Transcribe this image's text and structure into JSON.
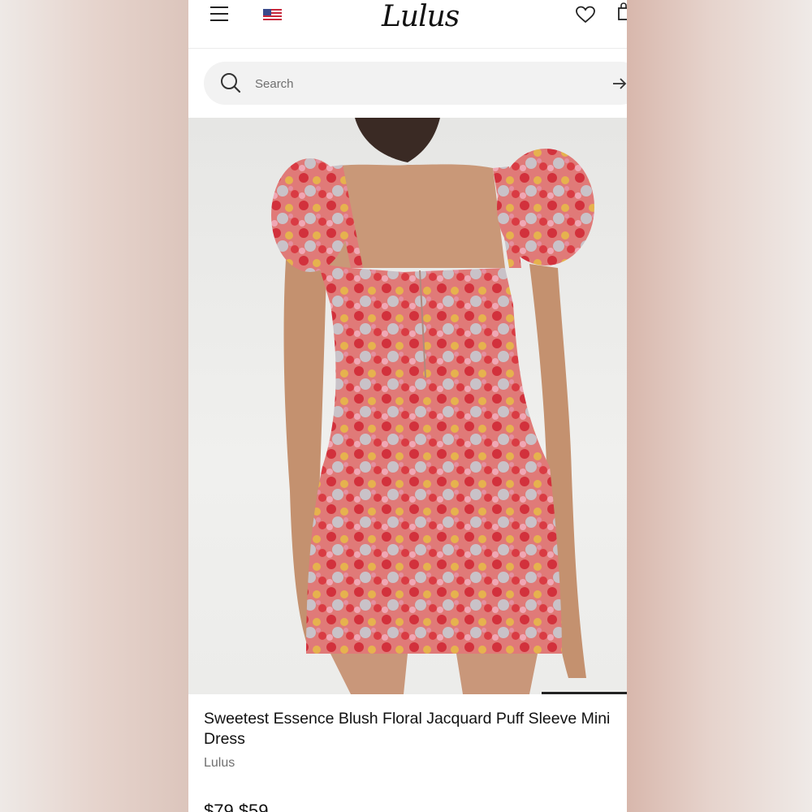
{
  "header": {
    "logo_text": "Lulus",
    "menu_icon": "hamburger-menu-icon",
    "flag_icon": "us-flag-icon",
    "wishlist_icon": "heart-icon",
    "bag_icon": "shopping-bag-icon"
  },
  "search": {
    "placeholder": "Search",
    "icon": "search-icon",
    "submit_icon": "arrow-right-icon"
  },
  "product": {
    "title": "Sweetest Essence Blush Floral Jacquard Puff Sleeve Mini Dress",
    "brand": "Lulus",
    "price": "$79 $59",
    "image_description": "model-back-view-floral-dress"
  },
  "colors": {
    "text": "#111111",
    "muted": "#707070",
    "search_bg": "#f2f2f2"
  }
}
